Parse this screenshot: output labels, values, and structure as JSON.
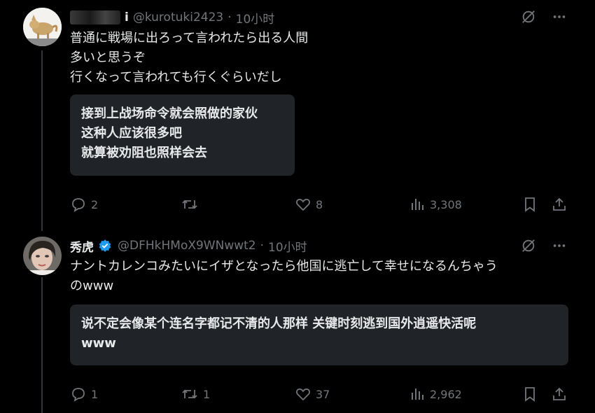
{
  "posts": [
    {
      "name": "i",
      "handle": "@kurotuki2423",
      "time": "10小时",
      "lines": [
        "普通に戦場に出ろって言われたら出る人間",
        "多いと思うぞ",
        "行くなって言われても行くぐらいだし"
      ],
      "translation": [
        "接到上战场命令就会照做的家伙",
        "这种人应该很多吧",
        "就算被劝阻也照样会去"
      ],
      "actions": {
        "replies": "2",
        "reposts": "",
        "likes": "8",
        "views": "3,308"
      }
    },
    {
      "name": "秀虎",
      "handle": "@DFHkHMoX9WNwwt2",
      "time": "10小时",
      "lines": [
        "ナントカレンコみたいにイザとなったら他国に逃亡して幸せになるんちゃう",
        "のwww"
      ],
      "translation": [
        "说不定会像某个连名字都记不清的人那样 关键时刻逃到国外逍遥快活呢",
        "www"
      ],
      "actions": {
        "replies": "1",
        "reposts": "1",
        "likes": "37",
        "views": "2,962"
      }
    }
  ],
  "colors": {
    "background": "#000000",
    "text": "#e7e9ea",
    "muted": "#71767b",
    "box": "#202327",
    "verified": "#1d9bf0"
  }
}
